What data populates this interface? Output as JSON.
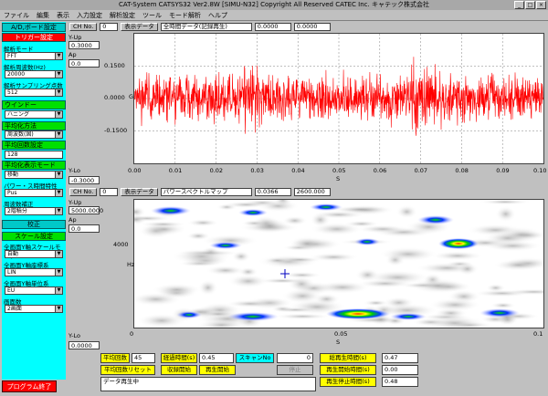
{
  "window": {
    "title": "CAT-System  CATSYS32  Ver2.8W  [SIMU-N32]  Copyright All Reserved CATEC Inc.  キャテック株式会社"
  },
  "menu": [
    "ファイル",
    "編集",
    "表示",
    "入力設定",
    "解析設定",
    "ツール",
    "モード解析",
    "ヘルプ"
  ],
  "left_panel": {
    "ad_setting": "A/D,ボード設定",
    "trigger_setting": "トリガー設定",
    "analysis_mode_label": "解析モード",
    "analysis_mode": "FFT",
    "freq_label": "解析周波数(Hz)",
    "freq": "20000",
    "samples_label": "解析サンプリング点数",
    "samples": "512",
    "window_label": "ウインドー",
    "window": "ハニング",
    "avg_method_label": "平均化方法",
    "avg_method": "周波数(固)",
    "avg_count_label": "平均回数設定",
    "avg_count": "128",
    "avg_mode_label": "平均化表示モード",
    "avg_mode": "移動",
    "power_spec_label": "パワー・ス時間特性",
    "power_spec": "Pus",
    "correction_label": "周波数補正",
    "correction": "2階積分",
    "calib": "校正",
    "scale_setting": "スケール設定",
    "auto_label": "全画面Y軸スケールモード",
    "auto": "自動",
    "axis_label": "全画面Y軸座標系",
    "axis": "LIN",
    "unit_label": "全画面Y軸単位系",
    "unit": "EU",
    "screens_label": "画面数",
    "screens": "2画面",
    "program_end": "プログラム終了"
  },
  "plot1": {
    "ch_label": "CH No.",
    "ch": "0",
    "disp_label": "表示データ",
    "disp": "全時間データ(記録再生)",
    "x_from": "0.0000",
    "x_to": "0.0000",
    "yup_label": "Y-Up",
    "yup": "0.3000",
    "ap_label": "Ap",
    "ap": "0.0",
    "ylo_label": "Y-Lo",
    "ylo": "-0.3000",
    "ylabel": "G",
    "xlabel": "S",
    "yticks": [
      "0.1500",
      "0.0000",
      "-0.1500"
    ],
    "xticks": [
      "0.00",
      "0.01",
      "0.02",
      "0.03",
      "0.04",
      "0.05",
      "0.06",
      "0.07",
      "0.08",
      "0.09",
      "0.10"
    ]
  },
  "plot2": {
    "ch_label": "CH No.",
    "ch": "0",
    "disp_label": "表示データ",
    "disp": "パワースペクトルマップ",
    "x_from": "0.0366",
    "x_to": "2600.000",
    "yup_label": "Y-Up",
    "yup": "5000.0000",
    "ap_label": "Ap",
    "ap": "0.0",
    "ylo_label": "Y-Lo",
    "ylo": "0.0000",
    "ylabel": "Hz",
    "xlabel": "S",
    "yticks": [
      "4000"
    ],
    "xticks": [
      "0",
      "0.05",
      "0.1"
    ]
  },
  "bottom": {
    "avg_count_label": "平均回数",
    "avg_count": "45",
    "elapsed_label": "経過時間(s)",
    "elapsed": "0.45",
    "scan_label": "スキャンNo",
    "scan": "0",
    "total_time_label": "総再生時間(s)",
    "total_time": "0.47",
    "reset_btn": "平均回数リセット",
    "record_start": "収録開始",
    "play_start": "再生開始",
    "stop": "停止",
    "play_start_time_label": "再生開始時間(s)",
    "play_start_time": "0.00",
    "play_end_time_label": "再生停止時間(s)",
    "play_end_time": "0.48",
    "status": "データ再生中"
  },
  "colors": {
    "signal": "#ff0000",
    "panel": "#00ffff",
    "accent_green": "#00e000",
    "warn": "#ff0000"
  }
}
